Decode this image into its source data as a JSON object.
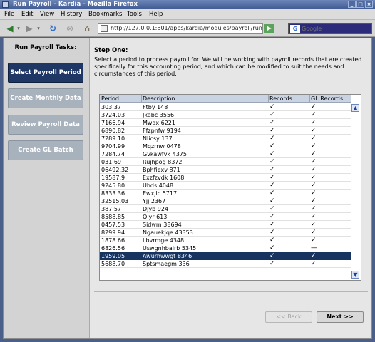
{
  "window": {
    "title": "Run Payroll - Kardia - Mozilla Firefox"
  },
  "menu": [
    "File",
    "Edit",
    "View",
    "History",
    "Bookmarks",
    "Tools",
    "Help"
  ],
  "nav": {
    "url": "http://127.0.0.1:801/apps/kardia/modules/payroll/runpa",
    "search_placeholder": "Google",
    "search_engine_icon": "G"
  },
  "sidebar": {
    "title": "Run Payroll Tasks:",
    "buttons": [
      {
        "label": "Select Payroll Period",
        "active": true
      },
      {
        "label": "Create Monthly Data",
        "active": false
      },
      {
        "label": "Review Payroll Data",
        "active": false
      },
      {
        "label": "Create GL Batch",
        "active": false
      }
    ]
  },
  "step": {
    "title": "Step One:",
    "description": "Select a period to process payroll for. We will be working with payroll records that are created specifically for this accounting period, and which can be modified to suit the needs and circumstances of this period."
  },
  "table": {
    "columns": [
      "Period",
      "Description",
      "Records",
      "GL Records"
    ],
    "rows": [
      {
        "period": "303.37",
        "desc": "Ftby 148",
        "records": "✓",
        "gl": "✓"
      },
      {
        "period": "3724.03",
        "desc": "Jkabc 3556",
        "records": "✓",
        "gl": "✓"
      },
      {
        "period": "7166.94",
        "desc": "Mwax 6221",
        "records": "✓",
        "gl": "✓"
      },
      {
        "period": "6890.82",
        "desc": "Ffzpnfw 9194",
        "records": "✓",
        "gl": "✓"
      },
      {
        "period": "7289.10",
        "desc": "Nlicsy 137",
        "records": "✓",
        "gl": "✓"
      },
      {
        "period": "9704.99",
        "desc": "Mqzrnw 0478",
        "records": "✓",
        "gl": "✓"
      },
      {
        "period": "7284.74",
        "desc": "Gvkawfvk 4375",
        "records": "✓",
        "gl": "✓"
      },
      {
        "period": "031.69",
        "desc": "Rujhpog 8372",
        "records": "✓",
        "gl": "✓"
      },
      {
        "period": "06492.32",
        "desc": "Bphfiexv 871",
        "records": "✓",
        "gl": "✓"
      },
      {
        "period": "19587.9",
        "desc": "Exzfzvdk 1608",
        "records": "✓",
        "gl": "✓"
      },
      {
        "period": "9245.80",
        "desc": "Uhds 4048",
        "records": "✓",
        "gl": "✓"
      },
      {
        "period": "8333.36",
        "desc": "Ewxjlc 5717",
        "records": "✓",
        "gl": "✓"
      },
      {
        "period": "32515.03",
        "desc": "Yjj 2367",
        "records": "✓",
        "gl": "✓"
      },
      {
        "period": "387.57",
        "desc": "Djyb 924",
        "records": "✓",
        "gl": "✓"
      },
      {
        "period": "8588.85",
        "desc": "Qiyr 613",
        "records": "✓",
        "gl": "✓"
      },
      {
        "period": "0457.53",
        "desc": "Sidwm 38694",
        "records": "✓",
        "gl": "✓"
      },
      {
        "period": "8299.94",
        "desc": "Ngauekjqe 43353",
        "records": "✓",
        "gl": "✓"
      },
      {
        "period": "1878.66",
        "desc": "Lbvrmge 4348",
        "records": "✓",
        "gl": "✓"
      },
      {
        "period": "6826.56",
        "desc": "Uswgnhbairb 5345",
        "records": "✓",
        "gl": "—"
      },
      {
        "period": "1959.05",
        "desc": "Awurhwwgt 8346",
        "records": "✓",
        "gl": "✓",
        "selected": true
      },
      {
        "period": "5688.70",
        "desc": "Sptsmaegm 336",
        "records": "✓",
        "gl": "✓"
      }
    ]
  },
  "buttons": {
    "back": "<< Back",
    "next": "Next >>"
  }
}
